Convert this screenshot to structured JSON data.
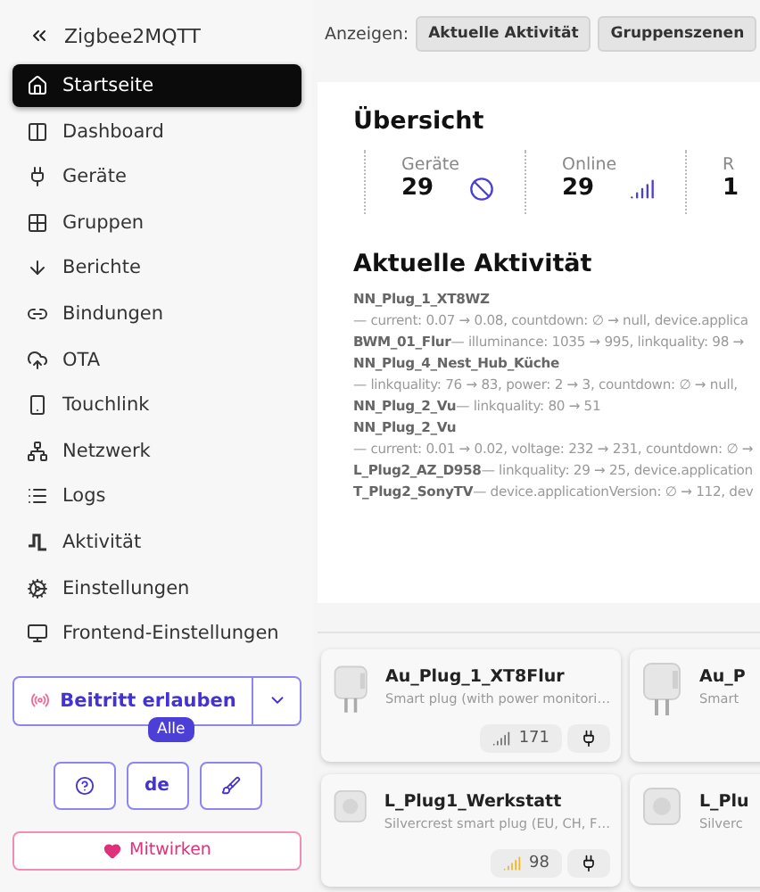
{
  "sidebar": {
    "title": "Zigbee2MQTT",
    "items": [
      {
        "label": "Startseite",
        "selected": true
      },
      {
        "label": "Dashboard",
        "selected": false
      },
      {
        "label": "Geräte",
        "selected": false
      },
      {
        "label": "Gruppen",
        "selected": false
      },
      {
        "label": "Berichte",
        "selected": false
      },
      {
        "label": "Bindungen",
        "selected": false
      },
      {
        "label": "OTA",
        "selected": false
      },
      {
        "label": "Touchlink",
        "selected": false
      },
      {
        "label": "Netzwerk",
        "selected": false
      },
      {
        "label": "Logs",
        "selected": false
      },
      {
        "label": "Aktivität",
        "selected": false
      },
      {
        "label": "Einstellungen",
        "selected": false
      },
      {
        "label": "Frontend-Einstellungen",
        "selected": false
      }
    ],
    "permit_join": {
      "label": "Beitritt erlauben",
      "badge": "Alle"
    },
    "language": "de",
    "contribute": "Mitwirken"
  },
  "toolbar": {
    "label": "Anzeigen:",
    "buttons": [
      "Aktuelle Aktivität",
      "Gruppenszenen"
    ]
  },
  "overview": {
    "title": "Übersicht",
    "stats": [
      {
        "label": "Geräte",
        "value": "29"
      },
      {
        "label": "Online",
        "value": "29"
      },
      {
        "label": "R",
        "value": "1"
      }
    ]
  },
  "activity": {
    "title": "Aktuelle Aktivität",
    "entries": [
      {
        "kind": "stacked",
        "device": "NN_Plug_1_XT8WZ",
        "changes": "— current: 0.07 → 0.08, countdown: ∅ → null, device.applica"
      },
      {
        "kind": "inline",
        "device": "BWM_01_Flur",
        "changes": "— illuminance: 1035 → 995, linkquality: 98 →"
      },
      {
        "kind": "stacked",
        "device": "NN_Plug_4_Nest_Hub_Küche",
        "changes": "— linkquality: 76 → 83, power: 2 → 3, countdown: ∅ → null,"
      },
      {
        "kind": "inline",
        "device": "NN_Plug_2_Vu",
        "changes": "— linkquality: 80 → 51"
      },
      {
        "kind": "stacked",
        "device": "NN_Plug_2_Vu",
        "changes": "— current: 0.01 → 0.02, voltage: 232 → 231, countdown: ∅ →"
      },
      {
        "kind": "inline",
        "device": "L_Plug2_AZ_D958",
        "changes": "— linkquality: 29 → 25, device.application"
      },
      {
        "kind": "inline",
        "device": "T_Plug2_SonyTV",
        "changes": "— device.applicationVersion: ∅ → 112, dev"
      }
    ]
  },
  "devices": [
    {
      "name": "Au_Plug_1_XT8Flur",
      "description": "Smart plug (with power monitori…",
      "linkquality": "171",
      "color": "#6e6e6e"
    },
    {
      "name": "Au_P",
      "description": "Smart"
    },
    {
      "name": "L_Plug1_Werkstatt",
      "description": "Silvercrest smart plug (EU, CH, F…",
      "linkquality": "98",
      "color": "#f0b429"
    },
    {
      "name": "L_Plu",
      "description": "Silverc"
    }
  ]
}
